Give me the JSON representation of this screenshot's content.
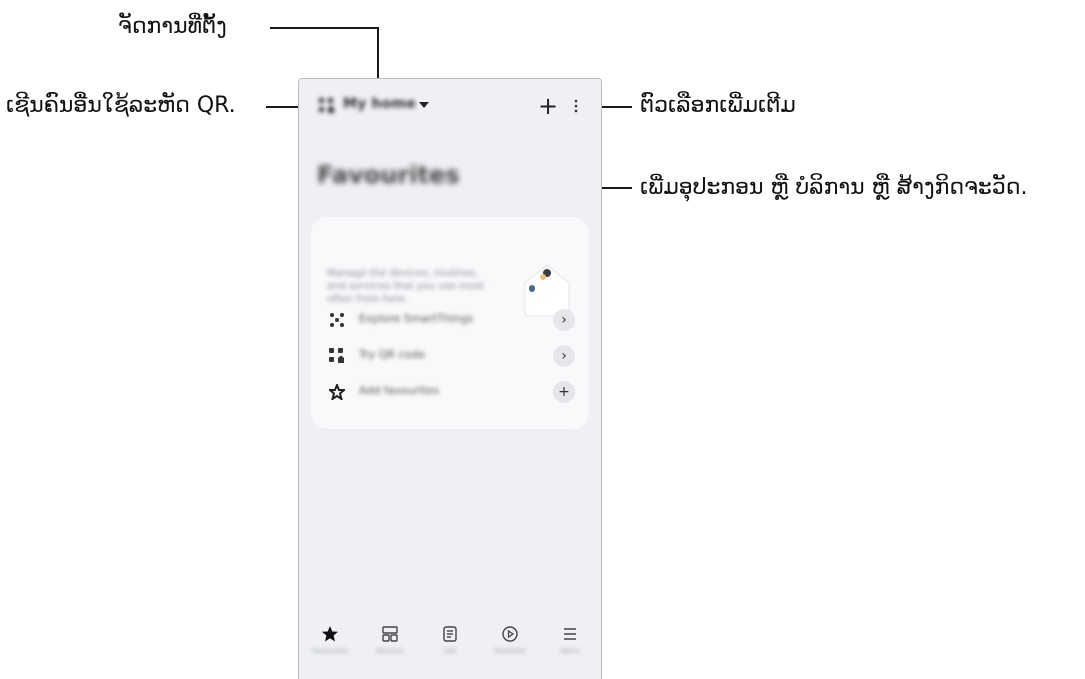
{
  "callouts": {
    "manage_location": "ຈັດການທີ່ຕັ້ງ",
    "invite_qr": "ເຊີນຄົນອື່ນໃຊ້ລະຫັດ QR.",
    "more_options": "ຕົວເລືອກເພີ່ມເຕີມ",
    "add_items": "ເພີ່ມອຸປະກອນ ຫຼື ບໍລິການ ຫຼື ສ້າງກິດຈະວັດ."
  },
  "app": {
    "home_name": "My home",
    "add_glyph": "+",
    "section_title": "Favourites",
    "card_description": [
      "Manage the devices, routines,",
      "and services that you use most",
      "often from here."
    ],
    "rows": [
      {
        "icon": "smartthings-icon",
        "label": "Explore SmartThings",
        "action": "›"
      },
      {
        "icon": "qr-code-icon",
        "label": "Try QR code",
        "action": "›"
      },
      {
        "icon": "star-outline-icon",
        "label": "Add favourites",
        "action": "+"
      }
    ],
    "nav": [
      {
        "icon": "star-icon",
        "label": "Favourites"
      },
      {
        "icon": "devices-icon",
        "label": "Devices"
      },
      {
        "icon": "life-icon",
        "label": "Life"
      },
      {
        "icon": "routines-icon",
        "label": "Routines"
      },
      {
        "icon": "menu-icon",
        "label": "Menu"
      }
    ]
  }
}
